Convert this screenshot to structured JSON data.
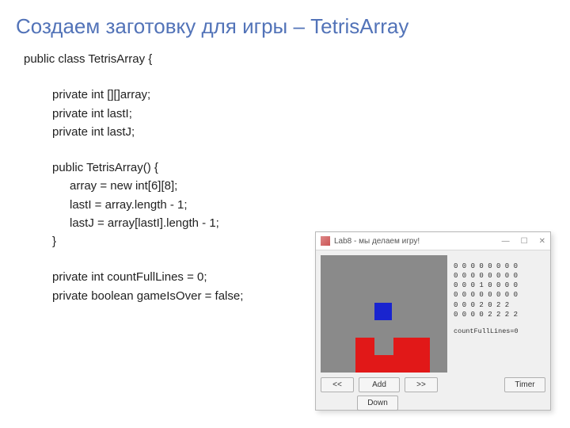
{
  "title": "Создаем заготовку для игры – TetrisArray",
  "code": {
    "l1": "public class TetrisArray {",
    "l2": "private int [][]array;",
    "l3": "private int lastI;",
    "l4": "private int lastJ;",
    "l5": "public TetrisArray() {",
    "l6": "array = new int[6][8];",
    "l7": "lastI = array.length - 1;",
    "l8": "lastJ = array[lastI].length - 1;",
    "l9": "}",
    "l10": "private int countFullLines = 0;",
    "l11": "private boolean gameIsOver = false;"
  },
  "window": {
    "title": "Lab8 - мы делаем игру!",
    "minimize": "—",
    "maximize": "☐",
    "close": "✕",
    "grid": {
      "r0": "0 0 0 0 0 0 0 0",
      "r1": "0 0 0 0 0 0 0 0",
      "r2": "0 0 0 1 0 0 0 0",
      "r3": "0 0 0 0 0 0 0 0",
      "r4": "0 0 0 2 0 2 2",
      "r5": "0 0 0 0 2 2 2 2"
    },
    "countFullLines": "countFullLines=0",
    "buttons": {
      "prev": "<<",
      "add": "Add",
      "next": ">>",
      "timer": "Timer",
      "down": "Down"
    }
  }
}
